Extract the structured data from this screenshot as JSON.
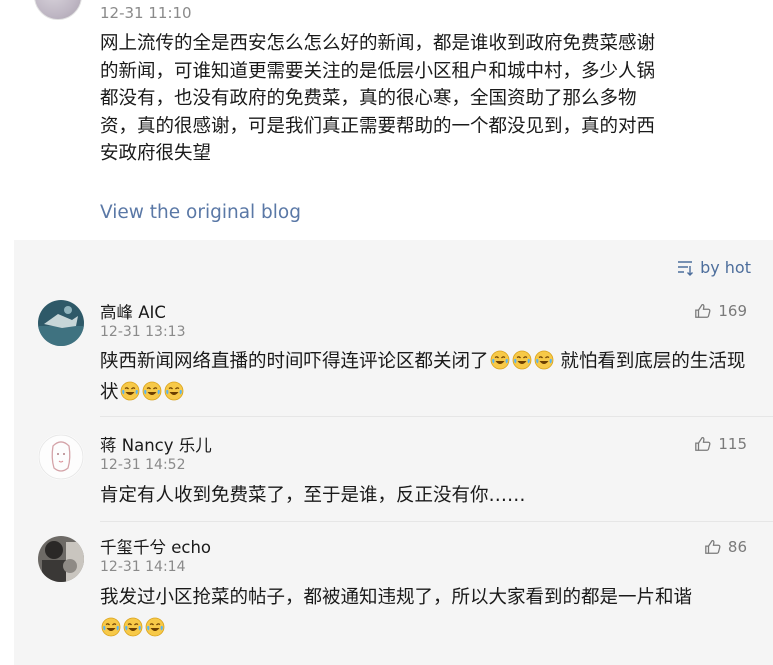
{
  "post": {
    "time": "12-31 11:10",
    "content": "网上流传的全是西安怎么怎么好的新闻，都是谁收到政府免费菜感谢的新闻，可谁知道更需要关注的是低层小区租户和城中村，多少人锅都没有，也没有政府的免费菜，真的很心寒，全国资助了那么多物资，真的很感谢，可是我们真正需要帮助的一个都没见到，真的对西安政府很失望",
    "link": "View the original blog"
  },
  "sort": {
    "label": "by hot",
    "icon": "sort-icon"
  },
  "comments": [
    {
      "name": "高峰 AIC",
      "time": "12-31 13:13",
      "likes": "169",
      "text_part1": "陕西新闻网络直播的时间吓得连评论区都关闭了",
      "text_part2": " 就怕看到底层的生活现状",
      "emoji": "laugh-cry-emoji"
    },
    {
      "name": "蒋 Nancy 乐儿",
      "time": "12-31 14:52",
      "likes": "115",
      "text": "肯定有人收到免费菜了，至于是谁，反正没有你……"
    },
    {
      "name": "千玺千兮 echo",
      "time": "12-31 14:14",
      "likes": "86",
      "text": "我发过小区抢菜的帖子，都被通知违规了，所以大家看到的都是一片和谐",
      "emoji": "laugh-cry-emoji"
    }
  ],
  "colors": {
    "link": "#5a78a6",
    "sort": "#4d6e9c",
    "panel": "#f5f5f5",
    "meta": "#8a8a8a"
  }
}
